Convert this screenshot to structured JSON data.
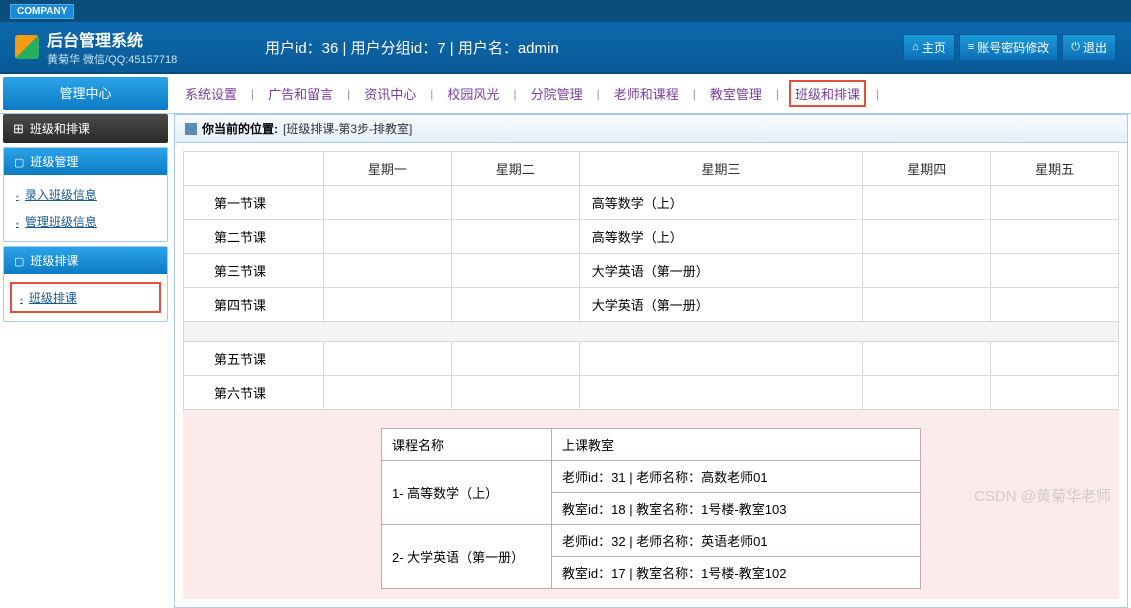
{
  "header": {
    "company_tag": "COMPANY",
    "title": "后台管理系统",
    "subtitle": "黄菊华 微信/QQ:45157718",
    "userinfo": "用户id：36 | 用户分组id：7 | 用户名：admin",
    "btn_home": "主页",
    "btn_pwd": "账号密码修改",
    "btn_logout": "退出"
  },
  "nav": {
    "mgmt_center": "管理中心",
    "items": [
      "系统设置",
      "广告和留言",
      "资讯中心",
      "校园风光",
      "分院管理",
      "老师和课程",
      "教室管理",
      "班级和排课"
    ]
  },
  "sidebar": {
    "header": "班级和排课",
    "sections": [
      {
        "title": "班级管理",
        "links": [
          "录入班级信息",
          "管理班级信息"
        ]
      },
      {
        "title": "班级排课",
        "links": [
          "班级排课"
        ]
      }
    ]
  },
  "breadcrumb": {
    "label": "你当前的位置:",
    "path": "[班级排课-第3步-排教室]"
  },
  "schedule": {
    "days": [
      "星期一",
      "星期二",
      "星期三",
      "星期四",
      "星期五"
    ],
    "rows_block1": [
      {
        "period": "第一节课",
        "d1": "",
        "d2": "",
        "d3": "高等数学（上）",
        "d4": "",
        "d5": ""
      },
      {
        "period": "第二节课",
        "d1": "",
        "d2": "",
        "d3": "高等数学（上）",
        "d4": "",
        "d5": ""
      },
      {
        "period": "第三节课",
        "d1": "",
        "d2": "",
        "d3": "大学英语（第一册）",
        "d4": "",
        "d5": ""
      },
      {
        "period": "第四节课",
        "d1": "",
        "d2": "",
        "d3": "大学英语（第一册）",
        "d4": "",
        "d5": ""
      }
    ],
    "rows_block2": [
      {
        "period": "第五节课",
        "d1": "",
        "d2": "",
        "d3": "",
        "d4": "",
        "d5": ""
      },
      {
        "period": "第六节课",
        "d1": "",
        "d2": "",
        "d3": "",
        "d4": "",
        "d5": ""
      }
    ]
  },
  "info": {
    "headers": [
      "课程名称",
      "上课教室"
    ],
    "rows": [
      {
        "course": "1- 高等数学（上）",
        "line1": "老师id：31 | 老师名称：高数老师01",
        "line2": "教室id：18 | 教室名称：1号楼-教室103"
      },
      {
        "course": "2- 大学英语（第一册）",
        "line1": "老师id：32 | 老师名称：英语老师01",
        "line2": "教室id：17 | 教室名称：1号楼-教室102"
      }
    ]
  },
  "watermark": "CSDN @黄菊华老师"
}
